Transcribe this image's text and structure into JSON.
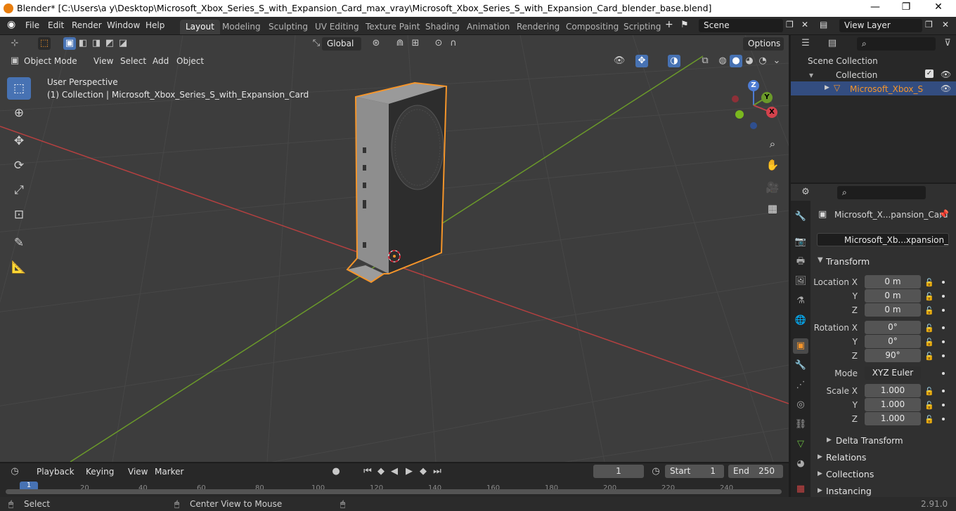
{
  "window": {
    "title": "Blender* [C:\\Users\\a y\\Desktop\\Microsoft_Xbox_Series_S_with_Expansion_Card_max_vray\\Microsoft_Xbox_Series_S_with_Expansion_Card_blender_base.blend]",
    "minimize": "—",
    "maximize": "❐",
    "close": "✕"
  },
  "menu": [
    "File",
    "Edit",
    "Render",
    "Window",
    "Help"
  ],
  "workspaces": [
    "Layout",
    "Modeling",
    "Sculpting",
    "UV Editing",
    "Texture Paint",
    "Shading",
    "Animation",
    "Rendering",
    "Compositing",
    "Scripting"
  ],
  "active_workspace": "Layout",
  "scene": "Scene",
  "view_layer": "View Layer",
  "viewport": {
    "transform_orientation": "Global",
    "options_label": "Options",
    "mode": "Object Mode",
    "menus": [
      "View",
      "Select",
      "Add",
      "Object"
    ],
    "perspective": "User Perspective",
    "collection_info": "(1) Collection | Microsoft_Xbox_Series_S_with_Expansion_Card",
    "gizmo": {
      "x": "X",
      "y": "Y",
      "z": "Z"
    }
  },
  "outliner": {
    "scene_collection": "Scene Collection",
    "collection": "Collection",
    "object": "Microsoft_Xbox_Serie"
  },
  "properties": {
    "object_name": "Microsoft_X...pansion_Card",
    "data_name": "Microsoft_Xb...xpansion_Card",
    "transform_title": "Transform",
    "location_label": "Location X",
    "location": [
      "0 m",
      "0 m",
      "0 m"
    ],
    "rotation_label": "Rotation X",
    "rotation": [
      "0°",
      "0°",
      "90°"
    ],
    "axis_y": "Y",
    "axis_z": "Z",
    "mode_label": "Mode",
    "mode_value": "XYZ Euler",
    "scale_label": "Scale X",
    "scale": [
      "1.000",
      "1.000",
      "1.000"
    ],
    "delta_transform": "Delta Transform",
    "relations": "Relations",
    "collections": "Collections",
    "instancing": "Instancing"
  },
  "timeline": {
    "menus": [
      "Playback",
      "Keying",
      "View",
      "Marker"
    ],
    "current_frame": "1",
    "start_label": "Start",
    "start": "1",
    "end_label": "End",
    "end": "250",
    "ticks": [
      "1",
      "20",
      "40",
      "60",
      "80",
      "100",
      "120",
      "140",
      "160",
      "180",
      "200",
      "220",
      "240"
    ]
  },
  "status": {
    "select": "Select",
    "center_view": "Center View to Mouse",
    "version": "2.91.0"
  },
  "colors": {
    "selection_outline": "#f5952a",
    "active_tool": "#4772b3",
    "x_axis": "#b54040",
    "y_axis": "#6b9a2a"
  }
}
